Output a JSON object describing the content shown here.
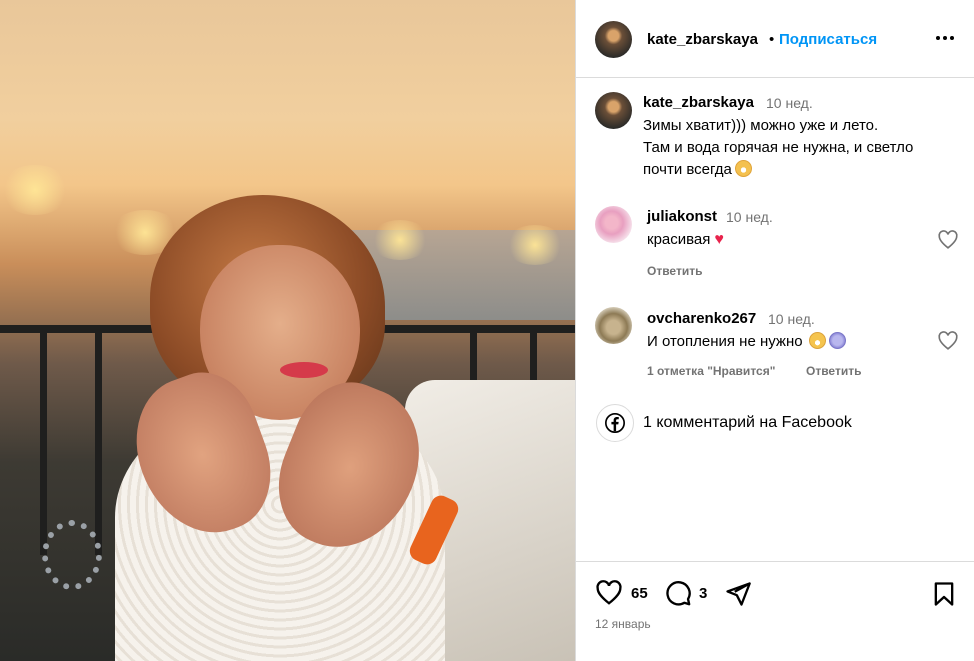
{
  "post": {
    "author": "kate_zbarskaya",
    "follow_label": "Подписаться",
    "separator": "•",
    "caption": {
      "author": "kate_zbarskaya",
      "time": "10 нед.",
      "line1": "Зимы хватит))) можно уже и лето.",
      "line2": "Там и вода горячая не нужна, и светло",
      "line3": "почти всегда"
    },
    "photo_icon": "heart-hands-photo"
  },
  "comments": [
    {
      "author": "juliakonst",
      "time": "10 нед.",
      "text": "красивая",
      "reply_label": "Ответить"
    },
    {
      "author": "ovcharenko267",
      "time": "10 нед.",
      "text": "И отопления не нужно",
      "likes_label": "1 отметка \"Нравится\"",
      "reply_label": "Ответить"
    }
  ],
  "facebook": {
    "text": "1 комментарий на Facebook",
    "icon": "facebook-icon"
  },
  "actions": {
    "likes": "65",
    "comments": "3",
    "date": "12 январь"
  },
  "colors": {
    "link": "#0095f6",
    "muted": "#737373",
    "border": "#dbdbdb",
    "heart": "#e8234c"
  }
}
